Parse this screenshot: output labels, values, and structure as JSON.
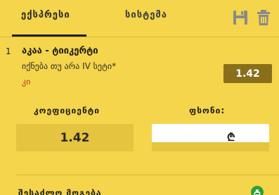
{
  "tabs": {
    "express": "ექსპრესი",
    "system": "სისტემა"
  },
  "toolbar": {
    "save_icon": "save-icon",
    "trash_icon": "trash-icon"
  },
  "bet": {
    "index": "1",
    "title": "აკაა - ტიიკერტი",
    "market": "იქნება თუ არა IV სეტი*",
    "selection": "კი",
    "odds": "1.42"
  },
  "summary": {
    "coef_label": "კოეფიციენტი",
    "coef_value": "1.42",
    "stake_label": "ფსონი:",
    "stake_value": "",
    "currency": "₾"
  },
  "footer": {
    "label": "შესაძლო მოგება"
  },
  "colors": {
    "background": "#f4d54b",
    "odds_badge": "#8a6f1a",
    "selection_text": "#c0392b",
    "box": "#e5c43f"
  }
}
